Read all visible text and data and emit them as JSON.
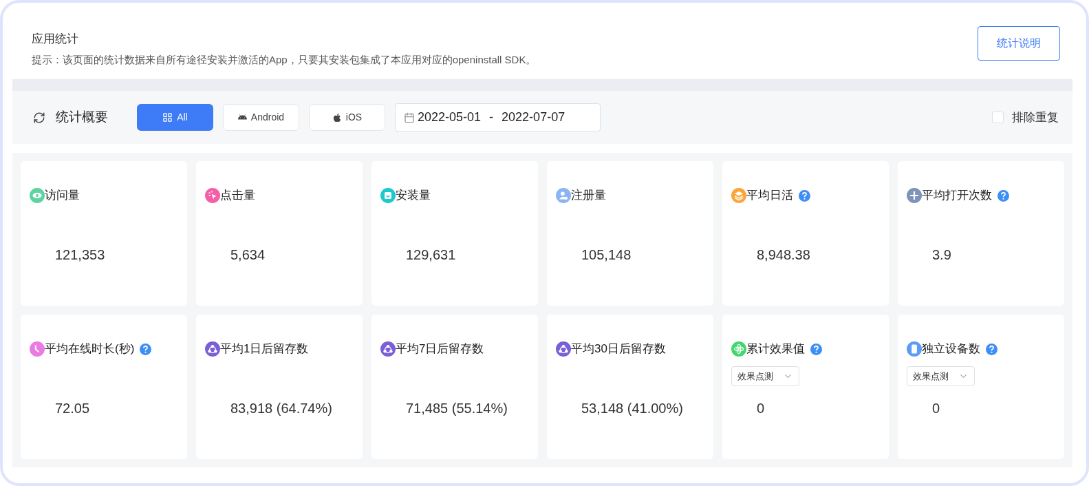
{
  "header": {
    "title": "应用统计",
    "hint": "提示：该页面的统计数据来自所有途径安装并激活的App，只要其安装包集成了本应用对应的openinstall SDK。",
    "help_button": "统计说明"
  },
  "toolbar": {
    "title": "统计概要",
    "platforms": [
      {
        "label": "All",
        "selected": true
      },
      {
        "label": "Android",
        "selected": false
      },
      {
        "label": "iOS",
        "selected": false
      }
    ],
    "date_start": "2022-05-01",
    "date_separator": "-",
    "date_end": "2022-07-07",
    "dedupe": {
      "label": "排除重复",
      "checked": false
    }
  },
  "cards": [
    {
      "title": "访问量",
      "color": "#5dd3a0",
      "help": false,
      "value": "121,353"
    },
    {
      "title": "点击量",
      "color": "#f55fa6",
      "help": false,
      "value": "5,634"
    },
    {
      "title": "安装量",
      "color": "#1cc9cf",
      "help": false,
      "value": "129,631"
    },
    {
      "title": "注册量",
      "color": "#8db4f2",
      "help": false,
      "value": "105,148"
    },
    {
      "title": "平均日活",
      "color": "#fba537",
      "help": true,
      "value": "8,948.38"
    },
    {
      "title": "平均打开次数",
      "color": "#7f93b8",
      "help": true,
      "value": "3.9"
    },
    {
      "title": "平均在线时长(秒)",
      "color": "#ea7be3",
      "help": true,
      "value": "72.05"
    },
    {
      "title": "平均1日后留存数",
      "color": "#7a5fd6",
      "help": false,
      "value": "83,918 (64.74%)"
    },
    {
      "title": "平均7日后留存数",
      "color": "#7a5fd6",
      "help": false,
      "value": "71,485 (55.14%)"
    },
    {
      "title": "平均30日后留存数",
      "color": "#7a5fd6",
      "help": false,
      "value": "53,148 (41.00%)"
    },
    {
      "title": "累计效果值",
      "color": "#43d66f",
      "help": true,
      "select": {
        "value": "效果点测"
      },
      "value": "0"
    },
    {
      "title": "独立设备数",
      "color": "#5c9cf6",
      "help": true,
      "select": {
        "value": "效果点测"
      },
      "value": "0"
    }
  ]
}
